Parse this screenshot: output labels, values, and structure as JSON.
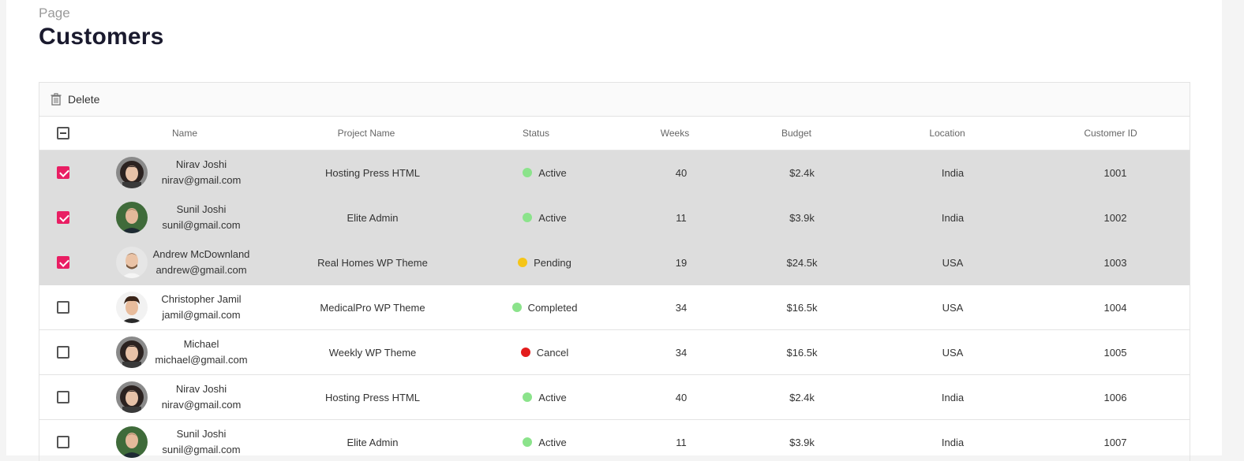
{
  "page": {
    "crumb": "Page",
    "title": "Customers"
  },
  "toolbar": {
    "delete_label": "Delete"
  },
  "columns": [
    "Name",
    "Project Name",
    "Status",
    "Weeks",
    "Budget",
    "Location",
    "Customer ID"
  ],
  "colors": {
    "selected_bg": "#dddddd",
    "accent": "#e91e63",
    "active": "#8be38b",
    "pending": "#f5c518",
    "completed": "#8be38b",
    "cancel": "#e31c1c"
  },
  "rows": [
    {
      "name": "Nirav Joshi",
      "email": "nirav@gmail.com",
      "project": "Hosting Press HTML",
      "status": "Active",
      "status_color": "#8be38b",
      "weeks": "40",
      "budget": "$2.4k",
      "location": "India",
      "cid": "1001",
      "checked": true,
      "avatar": "avatar-woman"
    },
    {
      "name": "Sunil Joshi",
      "email": "sunil@gmail.com",
      "project": "Elite Admin",
      "status": "Active",
      "status_color": "#8be38b",
      "weeks": "11",
      "budget": "$3.9k",
      "location": "India",
      "cid": "1002",
      "checked": true,
      "avatar": "avatar-man-green"
    },
    {
      "name": "Andrew McDownland",
      "email": "andrew@gmail.com",
      "project": "Real Homes WP Theme",
      "status": "Pending",
      "status_color": "#f5c518",
      "weeks": "19",
      "budget": "$24.5k",
      "location": "USA",
      "cid": "1003",
      "checked": true,
      "avatar": "avatar-man-light"
    },
    {
      "name": "Christopher Jamil",
      "email": "jamil@gmail.com",
      "project": "MedicalPro WP Theme",
      "status": "Completed",
      "status_color": "#8be38b",
      "weeks": "34",
      "budget": "$16.5k",
      "location": "USA",
      "cid": "1004",
      "checked": false,
      "avatar": "avatar-man-curly"
    },
    {
      "name": "Michael",
      "email": "michael@gmail.com",
      "project": "Weekly WP Theme",
      "status": "Cancel",
      "status_color": "#e31c1c",
      "weeks": "34",
      "budget": "$16.5k",
      "location": "USA",
      "cid": "1005",
      "checked": false,
      "avatar": "avatar-woman"
    },
    {
      "name": "Nirav Joshi",
      "email": "nirav@gmail.com",
      "project": "Hosting Press HTML",
      "status": "Active",
      "status_color": "#8be38b",
      "weeks": "40",
      "budget": "$2.4k",
      "location": "India",
      "cid": "1006",
      "checked": false,
      "avatar": "avatar-woman"
    },
    {
      "name": "Sunil Joshi",
      "email": "sunil@gmail.com",
      "project": "Elite Admin",
      "status": "Active",
      "status_color": "#8be38b",
      "weeks": "11",
      "budget": "$3.9k",
      "location": "India",
      "cid": "1007",
      "checked": false,
      "avatar": "avatar-man-green"
    }
  ]
}
